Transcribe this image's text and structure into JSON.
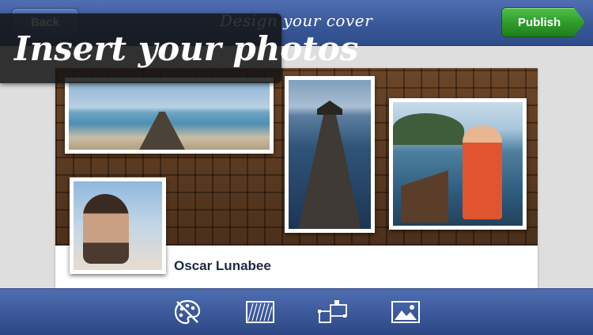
{
  "topbar": {
    "back_label": "Back",
    "title": "Design your cover",
    "publish_label": "Publish"
  },
  "banner": {
    "text": "Insert your photos"
  },
  "profile": {
    "name": "Oscar Lunabee"
  },
  "toolbar": {
    "tools": [
      "palette-icon",
      "pattern-icon",
      "layout-icon",
      "image-icon"
    ]
  },
  "colors": {
    "bar_blue": "#3b5899",
    "publish_green": "#2e9a2a",
    "cover_wood": "#5a3a22",
    "name_text": "#1c2a44"
  }
}
